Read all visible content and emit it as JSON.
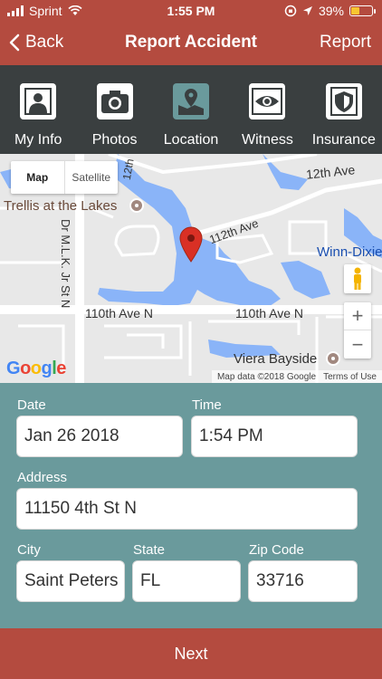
{
  "status_bar": {
    "carrier": "Sprint",
    "time": "1:55 PM",
    "battery": "39%",
    "battery_level": 0.39
  },
  "nav": {
    "back_label": "Back",
    "title": "Report Accident",
    "action_label": "Report"
  },
  "tabs": [
    {
      "label": "My Info",
      "icon": "person-icon",
      "active": false
    },
    {
      "label": "Photos",
      "icon": "camera-icon",
      "active": false
    },
    {
      "label": "Location",
      "icon": "map-pin-icon",
      "active": true
    },
    {
      "label": "Witness",
      "icon": "eye-icon",
      "active": false
    },
    {
      "label": "Insurance",
      "icon": "shield-icon",
      "active": false
    }
  ],
  "map": {
    "type_map": "Map",
    "type_satellite": "Satellite",
    "labels": {
      "st_12th": "12th Ave",
      "poi_trellis": "Trellis at the Lakes",
      "st_112th": "112th Ave",
      "winn_dixie": "Winn-Dixie",
      "st_mlk": "Dr M.L.K. Jr St N",
      "st_110th_left": "110th Ave N",
      "st_110th_right": "110th Ave N",
      "poi_viera": "Viera Bayside",
      "st_12th_left": "12th"
    },
    "zoom_in": "+",
    "zoom_out": "−",
    "attribution": "Map data ©2018 Google",
    "terms": "Terms of Use",
    "logo": "Google"
  },
  "form": {
    "date_label": "Date",
    "date_value": "Jan 26 2018",
    "time_label": "Time",
    "time_value": "1:54 PM",
    "address_label": "Address",
    "address_value": "11150 4th St N",
    "city_label": "City",
    "city_value": "Saint Peters",
    "state_label": "State",
    "state_value": "FL",
    "zip_label": "Zip Code",
    "zip_value": "33716"
  },
  "footer": {
    "next_label": "Next"
  },
  "colors": {
    "accent": "#b44b3f",
    "form_bg": "#6a9a9c",
    "tab_bg": "#3a3f40",
    "water": "#8ab4f8",
    "pin": "#d93025"
  }
}
